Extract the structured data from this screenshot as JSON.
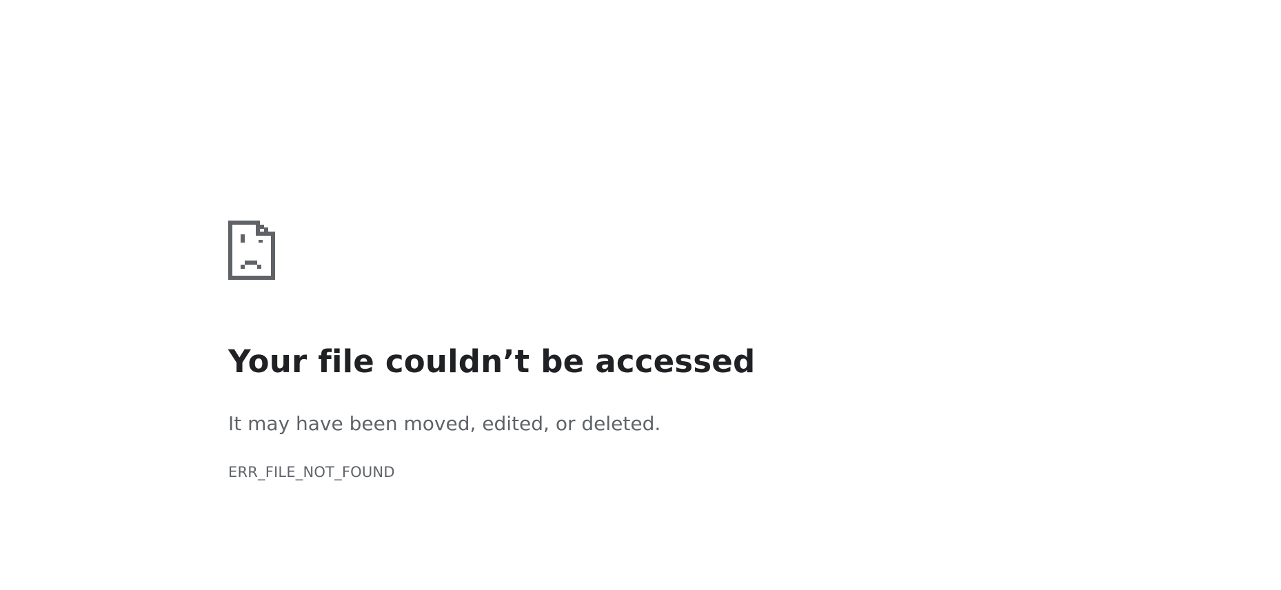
{
  "error_page": {
    "icon": "sad-file-icon",
    "headline": "Your file couldn’t be accessed",
    "subtitle": "It may have been moved, edited, or deleted.",
    "error_code": "ERR_FILE_NOT_FOUND"
  },
  "colors": {
    "background": "#ffffff",
    "headline": "#202124",
    "secondary_text": "#5f6368",
    "icon": "#5f6368"
  }
}
